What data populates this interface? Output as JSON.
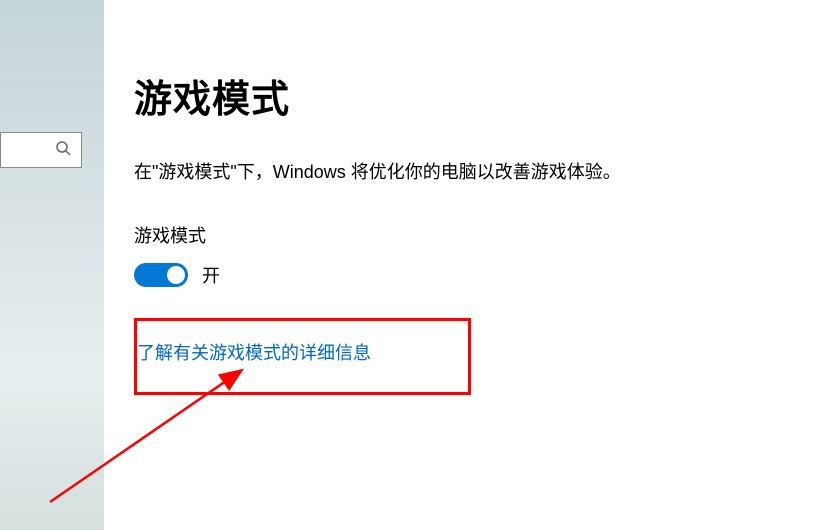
{
  "page": {
    "title": "游戏模式",
    "description": "在\"游戏模式\"下，Windows 将优化你的电脑以改善游戏体验。"
  },
  "toggle": {
    "label": "游戏模式",
    "state_label": "开",
    "on": true
  },
  "link": {
    "text": "了解有关游戏模式的详细信息"
  },
  "annotation": {
    "highlight_color": "#ff0000",
    "arrow_color": "#ff0000"
  }
}
